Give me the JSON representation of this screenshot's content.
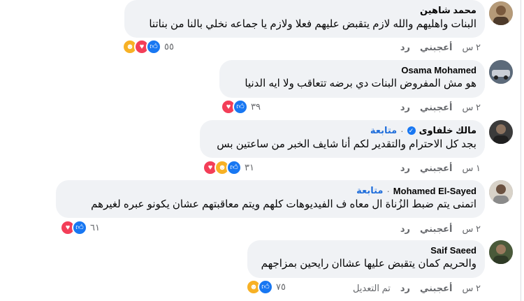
{
  "colors": {
    "bubble": "#f0f2f5",
    "link_blue": "#216fdb",
    "muted": "#65676b",
    "like": "#1877f2",
    "love": "#f33e58",
    "care": "#f7b125"
  },
  "action_labels": {
    "like": "أعجبني",
    "reply": "رد",
    "edited": "تم التعديل"
  },
  "comments": [
    {
      "author": "محمد شاهين",
      "text": "البنات واهليهم والله لازم يتقبض عليهم فعلا ولازم يا جماعه نخلي بالنا من بناتنا",
      "time": "٢ س",
      "reaction_count": "٥٥",
      "reaction_icons": [
        "care-icon",
        "love-icon",
        "like-icon"
      ]
    },
    {
      "author": "Osama Mohamed",
      "text": "هو مش المفروض البنات دي برضه تتعاقب ولا ايه الدنيا",
      "time": "٢ س",
      "reaction_count": "٣٩",
      "reaction_icons": [
        "love-icon",
        "like-icon"
      ]
    },
    {
      "author": "مالك خلفاوى",
      "verified": true,
      "follow": "متابعة",
      "text": "بجد كل الاحترام والتقدير لكم أنا شايف الخبر من ساعتين بس",
      "time": "١ س",
      "reaction_count": "٣١",
      "reaction_icons": [
        "love-icon",
        "care-icon",
        "like-icon"
      ]
    },
    {
      "author": "Mohamed El-Sayed",
      "follow": "متابعة",
      "text": "اتمنى يتم ضبط الزُناة ال معاه ف الفيديوهات كلهم ويتم معاقبتهم عشان يكونو عبره لغيرهم",
      "time": "٢ س",
      "reaction_count": "٦١",
      "reaction_icons": [
        "love-icon",
        "like-icon"
      ]
    },
    {
      "author": "Saif Saeed",
      "text": "والحريم كمان يتقبض عليها عشاان رايحين بمزاجهم",
      "time": "٢ س",
      "edited": true,
      "reaction_count": "٧٥",
      "reaction_icons": [
        "care-icon",
        "like-icon"
      ]
    }
  ]
}
